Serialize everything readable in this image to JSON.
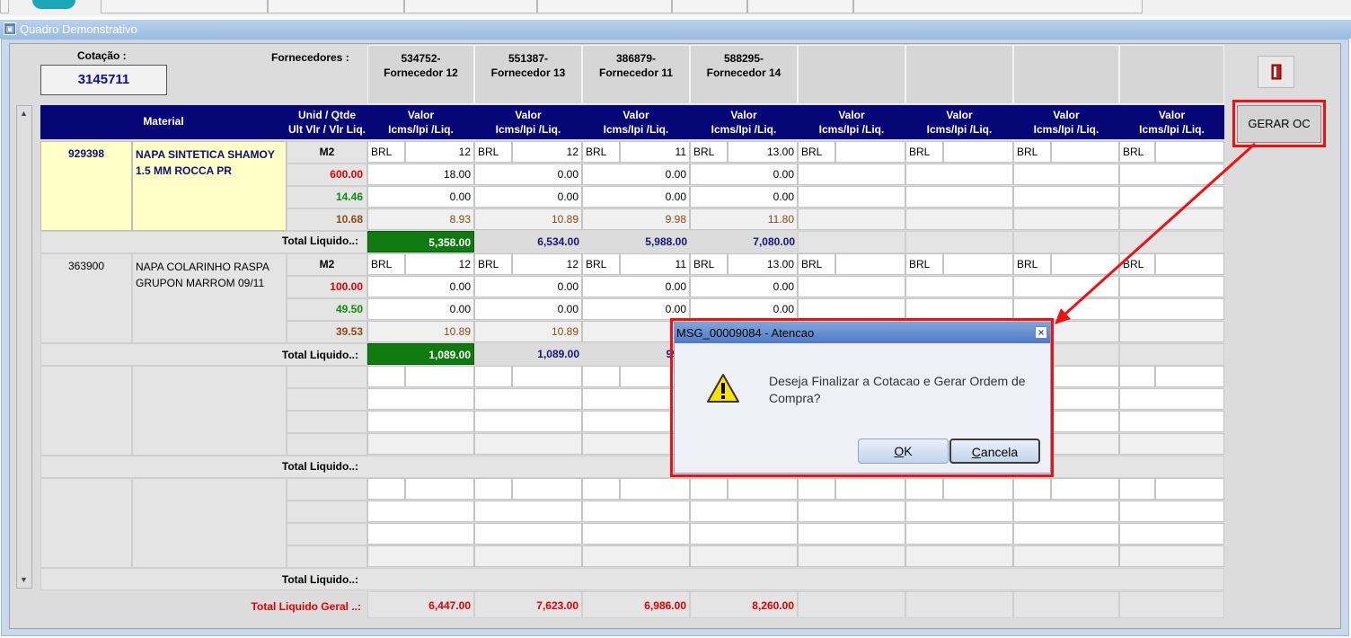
{
  "window": {
    "title": "Quadro Demonstrativo"
  },
  "colors": {
    "header_blue": "#060676",
    "highlight_red": "#ee1111",
    "total_green": "#0f7a0f",
    "material_yellow": "#ffffc8"
  },
  "icons": {
    "window_icon": "form-icon",
    "exit_icon": "exit-door-icon",
    "warning_icon": "warning-triangle-icon",
    "close_icon": "close-x-icon"
  },
  "header": {
    "cotacao_label": "Cotação :",
    "cotacao_value": "3145711",
    "fornecedores_label": "Fornecedores :",
    "suppliers": [
      {
        "code": "534752-",
        "name": "Fornecedor 12"
      },
      {
        "code": "551387-",
        "name": "Fornecedor 13"
      },
      {
        "code": "386879-",
        "name": "Fornecedor 11"
      },
      {
        "code": "588295-",
        "name": "Fornecedor 14"
      },
      {
        "code": "",
        "name": ""
      },
      {
        "code": "",
        "name": ""
      },
      {
        "code": "",
        "name": ""
      },
      {
        "code": "",
        "name": ""
      }
    ]
  },
  "columns": {
    "material": "Material",
    "unid_line1": "Unid / Qtde",
    "unid_line2": "Ult Vlr / Vlr Liq.",
    "valor_line1": "Valor",
    "valor_line2": "Icms/Ipi /Liq."
  },
  "materials": [
    {
      "code": "929398",
      "description": "NAPA SINTETICA SHAMOY 1.5 MM ROCCA PR",
      "unit": "M2",
      "qty": "600.00",
      "last_value": "14.46",
      "net_value": "10.68",
      "total_label": "Total Liquido..:",
      "suppliers": [
        {
          "currency": "BRL",
          "value": "12",
          "icms": "18.00",
          "ipi": "0.00",
          "liq": "8.93",
          "total": "5,358.00"
        },
        {
          "currency": "BRL",
          "value": "12",
          "icms": "0.00",
          "ipi": "0.00",
          "liq": "10.89",
          "total": "6,534.00"
        },
        {
          "currency": "BRL",
          "value": "11",
          "icms": "0.00",
          "ipi": "0.00",
          "liq": "9.98",
          "total": "5,988.00"
        },
        {
          "currency": "BRL",
          "value": "13.00",
          "icms": "0.00",
          "ipi": "0.00",
          "liq": "11.80",
          "total": "7,080.00"
        },
        {
          "currency": "BRL",
          "value": "",
          "icms": "",
          "ipi": "",
          "liq": "",
          "total": ""
        },
        {
          "currency": "BRL",
          "value": "",
          "icms": "",
          "ipi": "",
          "liq": "",
          "total": ""
        },
        {
          "currency": "BRL",
          "value": "",
          "icms": "",
          "ipi": "",
          "liq": "",
          "total": ""
        },
        {
          "currency": "BRL",
          "value": "",
          "icms": "",
          "ipi": "",
          "liq": "",
          "total": ""
        }
      ]
    },
    {
      "code": "363900",
      "description": "NAPA COLARINHO RASPA GRUPON MARROM 09/11",
      "unit": "M2",
      "qty": "100.00",
      "last_value": "49.50",
      "net_value": "39.53",
      "total_label": "Total Liquido..:",
      "suppliers": [
        {
          "currency": "BRL",
          "value": "12",
          "icms": "0.00",
          "ipi": "0.00",
          "liq": "10.89",
          "total": "1,089.00"
        },
        {
          "currency": "BRL",
          "value": "12",
          "icms": "0.00",
          "ipi": "0.00",
          "liq": "10.89",
          "total": "1,089.00"
        },
        {
          "currency": "BRL",
          "value": "11",
          "icms": "0.00",
          "ipi": "0.00",
          "liq": "9",
          "total": "998."
        },
        {
          "currency": "BRL",
          "value": "13.00",
          "icms": "0.00",
          "ipi": "0.00",
          "liq": "",
          "total": ""
        },
        {
          "currency": "BRL",
          "value": "",
          "icms": "",
          "ipi": "",
          "liq": "",
          "total": ""
        },
        {
          "currency": "BRL",
          "value": "",
          "icms": "",
          "ipi": "",
          "liq": "",
          "total": ""
        },
        {
          "currency": "BRL",
          "value": "",
          "icms": "",
          "ipi": "",
          "liq": "",
          "total": ""
        },
        {
          "currency": "BRL",
          "value": "",
          "icms": "",
          "ipi": "",
          "liq": "",
          "total": ""
        }
      ]
    }
  ],
  "empty_blocks": [
    {
      "total_label": "Total Liquido..:"
    },
    {
      "total_label": "Total Liquido..:"
    }
  ],
  "grand_total": {
    "label": "Total Liquido Geral ..:",
    "values": [
      "6,447.00",
      "7,623.00",
      "6,986.00",
      "8,260.00",
      "",
      "",
      "",
      ""
    ]
  },
  "actions": {
    "gerar_oc": "GERAR OC"
  },
  "dialog": {
    "title": "MSG_00009084 - Atencao",
    "close": "×",
    "message": "Deseja Finalizar a Cotacao e Gerar Ordem de Compra?",
    "ok": "OK",
    "cancel": "Cancela"
  }
}
